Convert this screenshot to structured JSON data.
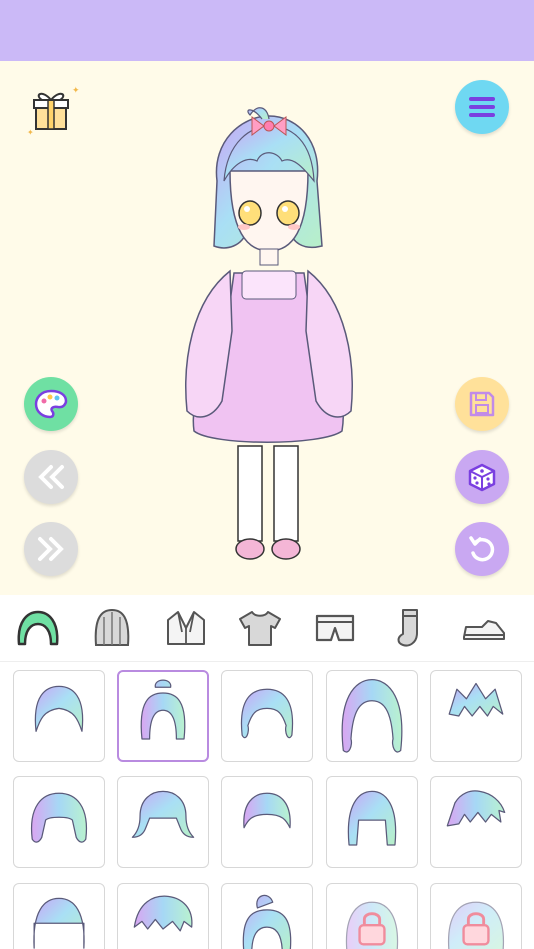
{
  "colors": {
    "topbar": "#cbb9f7",
    "stage_bg": "#fffbe9",
    "menu_button": "#6fd8f2",
    "palette_button": "#6fe0a3",
    "save_button": "#ffe19a",
    "dice_button": "#c9a8f2",
    "reset_button": "#c9a8f2",
    "nav_button": "#dcdcdc",
    "selected_border": "#b98be0"
  },
  "tabs": [
    {
      "id": "hair",
      "icon": "hair-icon",
      "active": true
    },
    {
      "id": "hair-back",
      "icon": "hair-back-icon",
      "active": false
    },
    {
      "id": "jacket",
      "icon": "jacket-icon",
      "active": false
    },
    {
      "id": "shirt",
      "icon": "shirt-icon",
      "active": false
    },
    {
      "id": "shorts",
      "icon": "shorts-icon",
      "active": false
    },
    {
      "id": "socks",
      "icon": "sock-icon",
      "active": false
    },
    {
      "id": "shoes",
      "icon": "shoe-icon",
      "active": false
    }
  ],
  "hair_items": [
    {
      "style": "short-bob",
      "selected": false,
      "locked": false
    },
    {
      "style": "bun-bob",
      "selected": true,
      "locked": false
    },
    {
      "style": "wavy-short",
      "selected": false,
      "locked": false
    },
    {
      "style": "long-wavy",
      "selected": false,
      "locked": false
    },
    {
      "style": "spiky",
      "selected": false,
      "locked": false
    },
    {
      "style": "curly-bob",
      "selected": false,
      "locked": false
    },
    {
      "style": "flip-out",
      "selected": false,
      "locked": false
    },
    {
      "style": "cap-cut",
      "selected": false,
      "locked": false
    },
    {
      "style": "straight-bob",
      "selected": false,
      "locked": false
    },
    {
      "style": "messy-short",
      "selected": false,
      "locked": false
    },
    {
      "style": "blunt-bangs",
      "selected": false,
      "locked": false
    },
    {
      "style": "side-swept",
      "selected": false,
      "locked": false
    },
    {
      "style": "top-bun",
      "selected": false,
      "locked": false
    },
    {
      "style": "round-locked",
      "selected": false,
      "locked": true
    },
    {
      "style": "curly-locked",
      "selected": false,
      "locked": true
    }
  ]
}
